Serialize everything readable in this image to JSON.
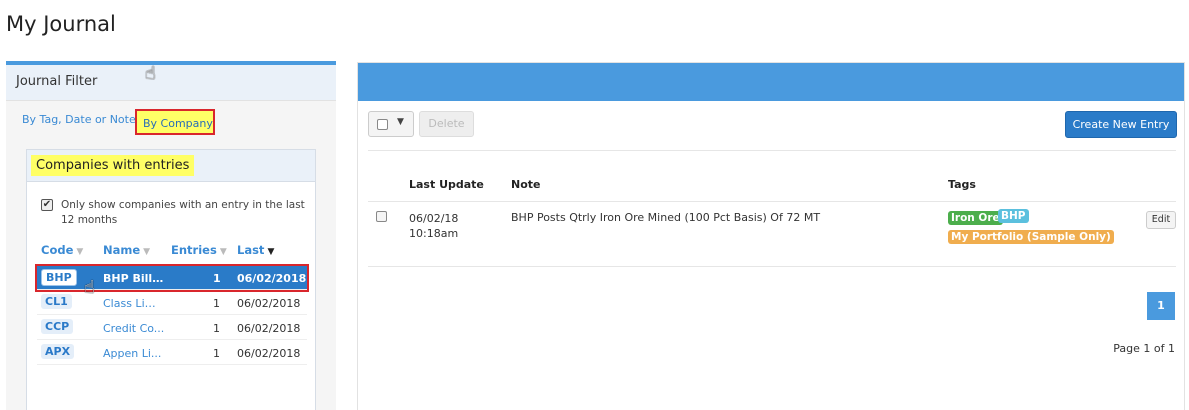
{
  "page": {
    "title": "My Journal"
  },
  "filter": {
    "header": "Journal Filter",
    "tabs": {
      "by_tag": "By Tag, Date or Note",
      "by_company": "By Company"
    },
    "companies_title": "Companies with entries",
    "only_show_label": "Only show companies with an entry in the last 12 months",
    "columns": {
      "code": "Code",
      "name": "Name",
      "entries": "Entries",
      "last": "Last"
    },
    "companies": [
      {
        "code": "BHP",
        "name": "BHP Billit...",
        "entries": "1",
        "last": "06/02/2018"
      },
      {
        "code": "CL1",
        "name": "Class Limi...",
        "entries": "1",
        "last": "06/02/2018"
      },
      {
        "code": "CCP",
        "name": "Credit Co...",
        "entries": "1",
        "last": "06/02/2018"
      },
      {
        "code": "APX",
        "name": "Appen Li...",
        "entries": "1",
        "last": "06/02/2018"
      }
    ]
  },
  "journal": {
    "toolbar": {
      "delete_label": "Delete",
      "create_label": "Create New Entry"
    },
    "columns": {
      "last_update": "Last Update",
      "note": "Note",
      "tags": "Tags"
    },
    "entries": [
      {
        "date": "06/02/18",
        "time": "10:18am",
        "note": "BHP Posts Qtrly Iron Ore Mined (100 Pct Basis) Of 72 MT",
        "tags": [
          "Iron Ore",
          "BHP",
          "My Portfolio (Sample Only)"
        ],
        "edit_label": "Edit"
      }
    ],
    "pagination": {
      "current": "1",
      "info": "Page 1 of 1"
    }
  },
  "colors": {
    "accent": "#4a9ade",
    "selected_row": "#2a7bc8",
    "highlight": "#ffff66",
    "annotation_red": "#d9262c",
    "tag_iron": "#4cae4c",
    "tag_bhp": "#5bc0de",
    "tag_portfolio": "#f0ad4e"
  }
}
